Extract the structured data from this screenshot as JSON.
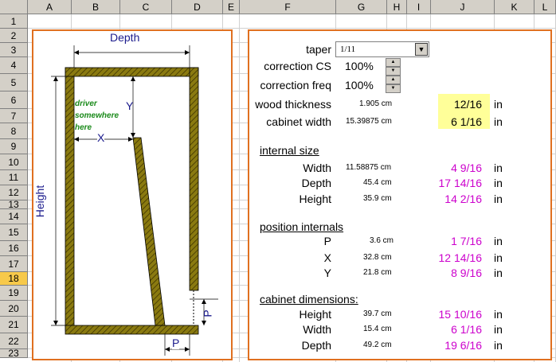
{
  "columns": [
    "A",
    "B",
    "C",
    "D",
    "E",
    "F",
    "G",
    "H",
    "I",
    "J",
    "K",
    "L"
  ],
  "rows": [
    "1",
    "2",
    "3",
    "4",
    "5",
    "6",
    "7",
    "8",
    "9",
    "10",
    "11",
    "12",
    "13",
    "14",
    "15",
    "16",
    "17",
    "18",
    "19",
    "20",
    "21",
    "22",
    "23"
  ],
  "selected_row": "18",
  "diagram": {
    "depth_label": "Depth",
    "height_label": "Height",
    "y_label": "Y",
    "x_label": "X",
    "p_label": "P",
    "driver_note": [
      "driver",
      "somewhere",
      "here"
    ]
  },
  "form": {
    "taper_label": "taper",
    "taper_value": "1/11",
    "correction_cs_label": "correction CS",
    "correction_cs_value": "100%",
    "correction_freq_label": "correction freq",
    "correction_freq_value": "100%",
    "wood_label": "wood thickness",
    "wood_cm": "1.905 cm",
    "wood_frac": "12/16",
    "wood_unit": "in",
    "cabinet_width_label": "cabinet width",
    "cabinet_width_cm": "15.39875 cm",
    "cabinet_width_frac": "6 1/16",
    "cabinet_width_unit": "in",
    "internal_size_title": "internal size",
    "internal": [
      {
        "label": "Width",
        "cm": "11.58875 cm",
        "frac": "4 9/16",
        "unit": "in"
      },
      {
        "label": "Depth",
        "cm": "45.4 cm",
        "frac": "17 14/16",
        "unit": "in"
      },
      {
        "label": "Height",
        "cm": "35.9 cm",
        "frac": "14 2/16",
        "unit": "in"
      }
    ],
    "position_title": "position internals",
    "position": [
      {
        "label": "P",
        "cm": "3.6 cm",
        "frac": "1 7/16",
        "unit": "in"
      },
      {
        "label": "X",
        "cm": "32.8 cm",
        "frac": "12 14/16",
        "unit": "in"
      },
      {
        "label": "Y",
        "cm": "21.8 cm",
        "frac": "8 9/16",
        "unit": "in"
      }
    ],
    "cabinet_title": "cabinet dimensions:",
    "cabinet": [
      {
        "label": "Height",
        "cm": "39.7 cm",
        "frac": "15 10/16",
        "unit": "in"
      },
      {
        "label": "Width",
        "cm": "15.4 cm",
        "frac": "6 1/16",
        "unit": "in"
      },
      {
        "label": "Depth",
        "cm": "49.2 cm",
        "frac": "19 6/16",
        "unit": "in"
      }
    ]
  },
  "colors": {
    "accent_border": "#e07020",
    "wood": "#7a6a10",
    "fraction": "#cc00cc",
    "highlight": "#ffff99",
    "dimension": "#1a1a8c"
  }
}
